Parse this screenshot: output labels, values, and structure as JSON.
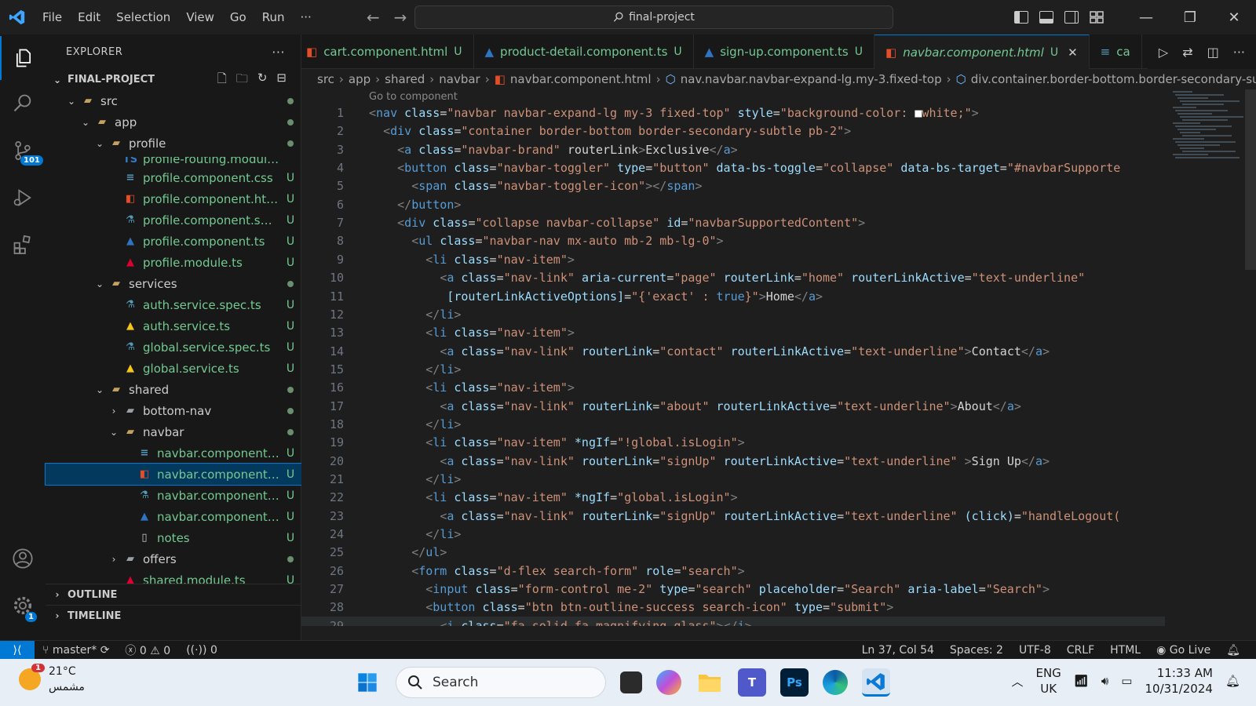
{
  "titlebar": {
    "menu": [
      "File",
      "Edit",
      "Selection",
      "View",
      "Go",
      "Run",
      "···"
    ],
    "command_center": "final-project"
  },
  "activity": {
    "source_control_badge": "101",
    "manage_badge": "1"
  },
  "explorer": {
    "header": "EXPLORER",
    "more": "···",
    "root": "FINAL-PROJECT",
    "items": [
      {
        "name": "src",
        "kind": "folder-open",
        "status": "dot"
      },
      {
        "name": "app",
        "kind": "folder-open",
        "status": "dot"
      },
      {
        "name": "profile",
        "kind": "folder-open",
        "status": "dot"
      },
      {
        "name": "profile-routing.module.ts",
        "kind": "ts",
        "status": ""
      },
      {
        "name": "profile.component.css",
        "kind": "css",
        "status": "U"
      },
      {
        "name": "profile.component.html",
        "kind": "html",
        "status": "U"
      },
      {
        "name": "profile.component.spec.ts",
        "kind": "spec",
        "status": "U"
      },
      {
        "name": "profile.component.ts",
        "kind": "ngts",
        "status": "U"
      },
      {
        "name": "profile.module.ts",
        "kind": "ngmod",
        "status": "U"
      },
      {
        "name": "services",
        "kind": "folder-open",
        "status": "dot"
      },
      {
        "name": "auth.service.spec.ts",
        "kind": "spec",
        "status": "U"
      },
      {
        "name": "auth.service.ts",
        "kind": "svc",
        "status": "U"
      },
      {
        "name": "global.service.spec.ts",
        "kind": "spec",
        "status": "U"
      },
      {
        "name": "global.service.ts",
        "kind": "svc",
        "status": "U"
      },
      {
        "name": "shared",
        "kind": "folder-open",
        "status": "dot"
      },
      {
        "name": "bottom-nav",
        "kind": "folder",
        "status": "dot"
      },
      {
        "name": "navbar",
        "kind": "folder-open",
        "status": "dot"
      },
      {
        "name": "navbar.component.css",
        "kind": "css",
        "status": "U"
      },
      {
        "name": "navbar.component.html",
        "kind": "html",
        "status": "U"
      },
      {
        "name": "navbar.component.spe...",
        "kind": "spec",
        "status": "U"
      },
      {
        "name": "navbar.component.ts",
        "kind": "ngts",
        "status": "U"
      },
      {
        "name": "notes",
        "kind": "file",
        "status": "U"
      },
      {
        "name": "offers",
        "kind": "folder",
        "status": "dot"
      },
      {
        "name": "shared.module.ts",
        "kind": "ngmod",
        "status": "U"
      }
    ],
    "outline": "OUTLINE",
    "timeline": "TIMELINE"
  },
  "tabs": [
    {
      "label": "cart.component.html",
      "status": "U"
    },
    {
      "label": "product-detail.component.ts",
      "status": "U"
    },
    {
      "label": "sign-up.component.ts",
      "status": "U"
    },
    {
      "label": "navbar.component.html",
      "status": "U"
    },
    {
      "label": "ca",
      "status": ""
    }
  ],
  "breadcrumb": [
    "src",
    "app",
    "shared",
    "navbar",
    "navbar.component.html",
    "nav.navbar.navbar-expand-lg.my-3.fixed-top",
    "div.container.border-bottom.border-secondary-sub"
  ],
  "editor": {
    "codelens": "Go to component",
    "lines": [
      "<nav class=\"navbar navbar-expand-lg my-3 fixed-top\" style=\"background-color: ■white;\">",
      "  <div class=\"container border-bottom border-secondary-subtle pb-2\">",
      "    <a class=\"navbar-brand\" routerLink>Exclusive</a>",
      "    <button class=\"navbar-toggler\" type=\"button\" data-bs-toggle=\"collapse\" data-bs-target=\"#navbarSupporte",
      "      <span class=\"navbar-toggler-icon\"></span>",
      "    </button>",
      "    <div class=\"collapse navbar-collapse\" id=\"navbarSupportedContent\">",
      "      <ul class=\"navbar-nav mx-auto mb-2 mb-lg-0\">",
      "        <li class=\"nav-item\">",
      "          <a class=\"nav-link\" aria-current=\"page\" routerLink=\"home\" routerLinkActive=\"text-underline\"",
      "           [routerLinkActiveOptions]=\"{'exact' : true}\">Home</a>",
      "        </li>",
      "        <li class=\"nav-item\">",
      "          <a class=\"nav-link\" routerLink=\"contact\" routerLinkActive=\"text-underline\">Contact</a>",
      "        </li>",
      "        <li class=\"nav-item\">",
      "          <a class=\"nav-link\" routerLink=\"about\" routerLinkActive=\"text-underline\">About</a>",
      "        </li>",
      "        <li class=\"nav-item\" *ngIf=\"!global.isLogin\">",
      "          <a class=\"nav-link\" routerLink=\"signUp\" routerLinkActive=\"text-underline\" >Sign Up</a>",
      "        </li>",
      "        <li class=\"nav-item\" *ngIf=\"global.isLogin\">",
      "          <a class=\"nav-link\" routerLink=\"signUp\" routerLinkActive=\"text-underline\" (click)=\"handleLogout(",
      "        </li>",
      "      </ul>",
      "      <form class=\"d-flex search-form\" role=\"search\">",
      "        <input class=\"form-control me-2\" type=\"search\" placeholder=\"Search\" aria-label=\"Search\">",
      "        <button class=\"btn btn-outline-success search-icon\" type=\"submit\">",
      "          <i class=\"fa-solid fa-magnifying-glass\"></i>"
    ]
  },
  "status": {
    "branch": "master*",
    "errors": "0",
    "warnings": "0",
    "ports": "0",
    "position": "Ln 37, Col 54",
    "spaces": "Spaces: 2",
    "encoding": "UTF-8",
    "eol": "CRLF",
    "language": "HTML",
    "golive": "Go Live"
  },
  "taskbar": {
    "weather_badge": "1",
    "temperature": "21°C",
    "condition": "مشمس",
    "search": "Search",
    "lang1": "ENG",
    "lang2": "UK",
    "time": "11:33 AM",
    "date": "10/31/2024"
  },
  "colors": {
    "accent": "#0078d4",
    "untracked": "#73c991",
    "tag": "#569cd6",
    "attr": "#9cdcfe",
    "string": "#ce9178"
  }
}
